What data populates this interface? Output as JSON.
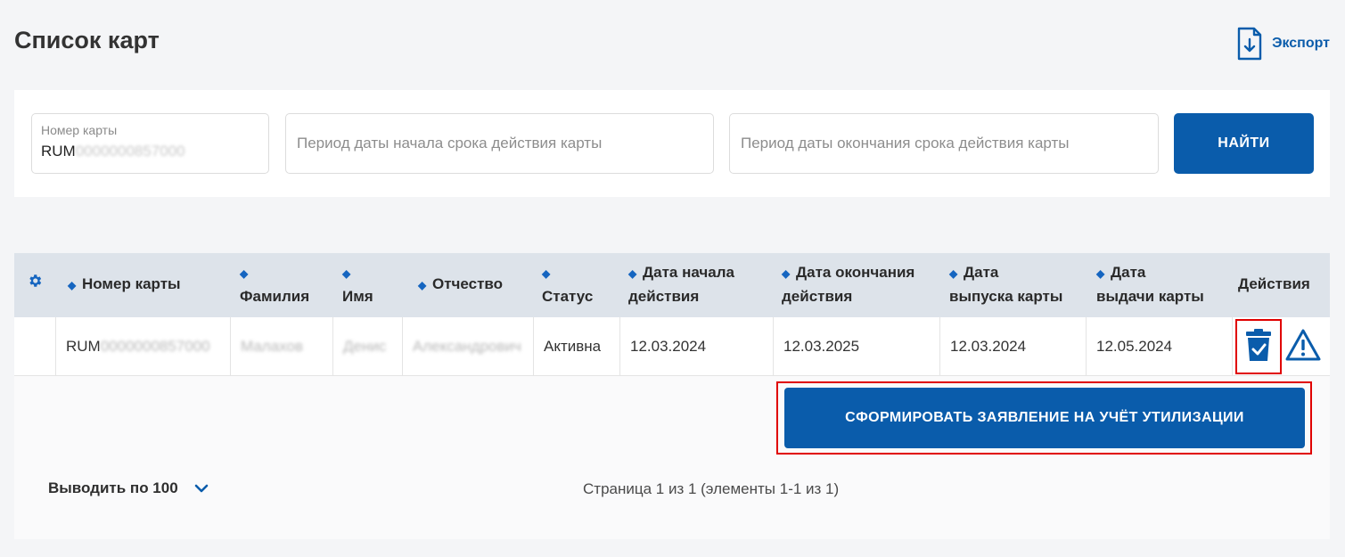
{
  "page": {
    "title": "Список карт",
    "export_label": "Экспорт"
  },
  "filters": {
    "card_number_label": "Номер карты",
    "card_number_prefix": "RUM",
    "card_number_masked": "0000000857000",
    "period_start_placeholder": "Период даты начала срока действия карты",
    "period_end_placeholder": "Период даты окончания срока действия карты",
    "find_button": "НАЙТИ"
  },
  "table": {
    "columns": [
      "Номер карты",
      "Фамилия",
      "Имя",
      "Отчество",
      "Статус",
      "Дата начала действия",
      "Дата окончания действия",
      "Дата выпуска карты",
      "Дата выдачи карты",
      "Действия"
    ],
    "column_lines": {
      "start_1": "Дата начала",
      "start_2": "действия",
      "end_1": "Дата окончания",
      "end_2": "действия",
      "issue_1": "Дата",
      "issue_2": "выпуска карты",
      "handout_1": "Дата",
      "handout_2": "выдачи карты"
    },
    "rows": [
      {
        "card_prefix": "RUM",
        "card_masked": "0000000857000",
        "last_name": "Малахов",
        "first_name": "Денис",
        "patronymic": "Александрович",
        "status": "Активна",
        "start_date": "12.03.2024",
        "end_date": "12.03.2025",
        "issue_date": "12.03.2024",
        "handout_date": "12.05.2024"
      }
    ]
  },
  "form_button": "СФОРМИРОВАТЬ ЗАЯВЛЕНИЕ НА УЧЁТ УТИЛИЗАЦИИ",
  "pagination": {
    "per_page_label": "Выводить по 100",
    "page_info": "Страница 1 из 1 (элементы 1-1 из 1)"
  },
  "colors": {
    "accent": "#0a5cab",
    "header_bg": "#dde3ea",
    "highlight": "#e00000"
  },
  "icons": [
    "export-icon",
    "settings-icon",
    "sort-icon",
    "trash-check-icon",
    "warning-icon",
    "chevron-down-icon"
  ]
}
